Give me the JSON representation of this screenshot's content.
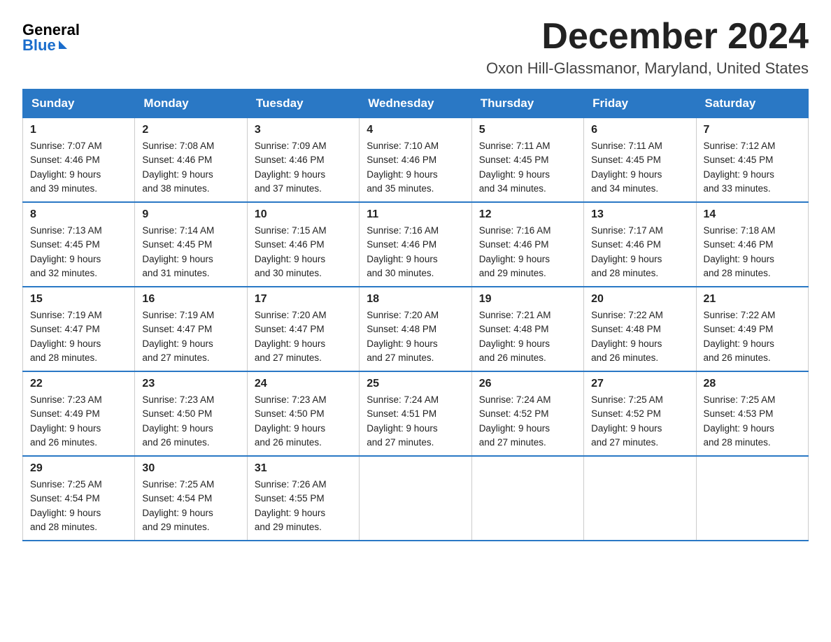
{
  "logo": {
    "general": "General",
    "blue": "Blue"
  },
  "title": "December 2024",
  "location": "Oxon Hill-Glassmanor, Maryland, United States",
  "days_of_week": [
    "Sunday",
    "Monday",
    "Tuesday",
    "Wednesday",
    "Thursday",
    "Friday",
    "Saturday"
  ],
  "weeks": [
    [
      {
        "day": "1",
        "sunrise": "7:07 AM",
        "sunset": "4:46 PM",
        "daylight": "9 hours and 39 minutes."
      },
      {
        "day": "2",
        "sunrise": "7:08 AM",
        "sunset": "4:46 PM",
        "daylight": "9 hours and 38 minutes."
      },
      {
        "day": "3",
        "sunrise": "7:09 AM",
        "sunset": "4:46 PM",
        "daylight": "9 hours and 37 minutes."
      },
      {
        "day": "4",
        "sunrise": "7:10 AM",
        "sunset": "4:46 PM",
        "daylight": "9 hours and 35 minutes."
      },
      {
        "day": "5",
        "sunrise": "7:11 AM",
        "sunset": "4:45 PM",
        "daylight": "9 hours and 34 minutes."
      },
      {
        "day": "6",
        "sunrise": "7:11 AM",
        "sunset": "4:45 PM",
        "daylight": "9 hours and 34 minutes."
      },
      {
        "day": "7",
        "sunrise": "7:12 AM",
        "sunset": "4:45 PM",
        "daylight": "9 hours and 33 minutes."
      }
    ],
    [
      {
        "day": "8",
        "sunrise": "7:13 AM",
        "sunset": "4:45 PM",
        "daylight": "9 hours and 32 minutes."
      },
      {
        "day": "9",
        "sunrise": "7:14 AM",
        "sunset": "4:45 PM",
        "daylight": "9 hours and 31 minutes."
      },
      {
        "day": "10",
        "sunrise": "7:15 AM",
        "sunset": "4:46 PM",
        "daylight": "9 hours and 30 minutes."
      },
      {
        "day": "11",
        "sunrise": "7:16 AM",
        "sunset": "4:46 PM",
        "daylight": "9 hours and 30 minutes."
      },
      {
        "day": "12",
        "sunrise": "7:16 AM",
        "sunset": "4:46 PM",
        "daylight": "9 hours and 29 minutes."
      },
      {
        "day": "13",
        "sunrise": "7:17 AM",
        "sunset": "4:46 PM",
        "daylight": "9 hours and 28 minutes."
      },
      {
        "day": "14",
        "sunrise": "7:18 AM",
        "sunset": "4:46 PM",
        "daylight": "9 hours and 28 minutes."
      }
    ],
    [
      {
        "day": "15",
        "sunrise": "7:19 AM",
        "sunset": "4:47 PM",
        "daylight": "9 hours and 28 minutes."
      },
      {
        "day": "16",
        "sunrise": "7:19 AM",
        "sunset": "4:47 PM",
        "daylight": "9 hours and 27 minutes."
      },
      {
        "day": "17",
        "sunrise": "7:20 AM",
        "sunset": "4:47 PM",
        "daylight": "9 hours and 27 minutes."
      },
      {
        "day": "18",
        "sunrise": "7:20 AM",
        "sunset": "4:48 PM",
        "daylight": "9 hours and 27 minutes."
      },
      {
        "day": "19",
        "sunrise": "7:21 AM",
        "sunset": "4:48 PM",
        "daylight": "9 hours and 26 minutes."
      },
      {
        "day": "20",
        "sunrise": "7:22 AM",
        "sunset": "4:48 PM",
        "daylight": "9 hours and 26 minutes."
      },
      {
        "day": "21",
        "sunrise": "7:22 AM",
        "sunset": "4:49 PM",
        "daylight": "9 hours and 26 minutes."
      }
    ],
    [
      {
        "day": "22",
        "sunrise": "7:23 AM",
        "sunset": "4:49 PM",
        "daylight": "9 hours and 26 minutes."
      },
      {
        "day": "23",
        "sunrise": "7:23 AM",
        "sunset": "4:50 PM",
        "daylight": "9 hours and 26 minutes."
      },
      {
        "day": "24",
        "sunrise": "7:23 AM",
        "sunset": "4:50 PM",
        "daylight": "9 hours and 26 minutes."
      },
      {
        "day": "25",
        "sunrise": "7:24 AM",
        "sunset": "4:51 PM",
        "daylight": "9 hours and 27 minutes."
      },
      {
        "day": "26",
        "sunrise": "7:24 AM",
        "sunset": "4:52 PM",
        "daylight": "9 hours and 27 minutes."
      },
      {
        "day": "27",
        "sunrise": "7:25 AM",
        "sunset": "4:52 PM",
        "daylight": "9 hours and 27 minutes."
      },
      {
        "day": "28",
        "sunrise": "7:25 AM",
        "sunset": "4:53 PM",
        "daylight": "9 hours and 28 minutes."
      }
    ],
    [
      {
        "day": "29",
        "sunrise": "7:25 AM",
        "sunset": "4:54 PM",
        "daylight": "9 hours and 28 minutes."
      },
      {
        "day": "30",
        "sunrise": "7:25 AM",
        "sunset": "4:54 PM",
        "daylight": "9 hours and 29 minutes."
      },
      {
        "day": "31",
        "sunrise": "7:26 AM",
        "sunset": "4:55 PM",
        "daylight": "9 hours and 29 minutes."
      },
      null,
      null,
      null,
      null
    ]
  ],
  "labels": {
    "sunrise": "Sunrise:",
    "sunset": "Sunset:",
    "daylight": "Daylight:"
  }
}
